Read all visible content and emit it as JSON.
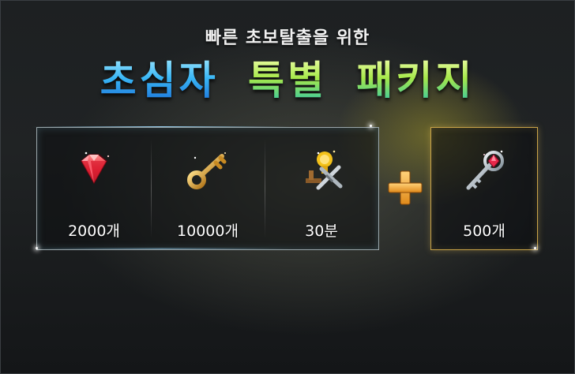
{
  "banner": {
    "subtitle": "빠른 초보탈출을 위한",
    "title_part1": "초심자",
    "title_part2": "특별",
    "title_part3": "패키지"
  },
  "items": [
    {
      "icon": "red-gem-icon",
      "label": "2000개"
    },
    {
      "icon": "gold-key-icon",
      "label": "10000개"
    },
    {
      "icon": "hourglass-swords-icon",
      "label": "30분"
    }
  ],
  "bonus": {
    "icon": "crystal-key-icon",
    "label": "500개"
  },
  "colors": {
    "title_blue": "#39b6f5",
    "title_green": "#a6e84a",
    "bonus_border": "#c9a348",
    "plus": "#f0a030"
  }
}
